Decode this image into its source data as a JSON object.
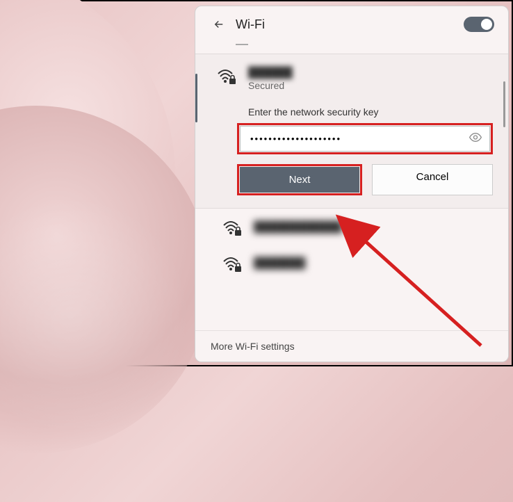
{
  "header": {
    "title": "Wi-Fi",
    "toggle_on": true
  },
  "active_network": {
    "ssid": "██████",
    "status": "Secured",
    "prompt": "Enter the network security key",
    "password_value": "••••••••••••••••••••",
    "next_label": "Next",
    "cancel_label": "Cancel"
  },
  "other_networks": [
    {
      "ssid": "████████████"
    },
    {
      "ssid": "███████"
    }
  ],
  "footer": {
    "more_settings": "More Wi-Fi settings"
  },
  "annotations": {
    "highlight_color": "#d62020"
  }
}
